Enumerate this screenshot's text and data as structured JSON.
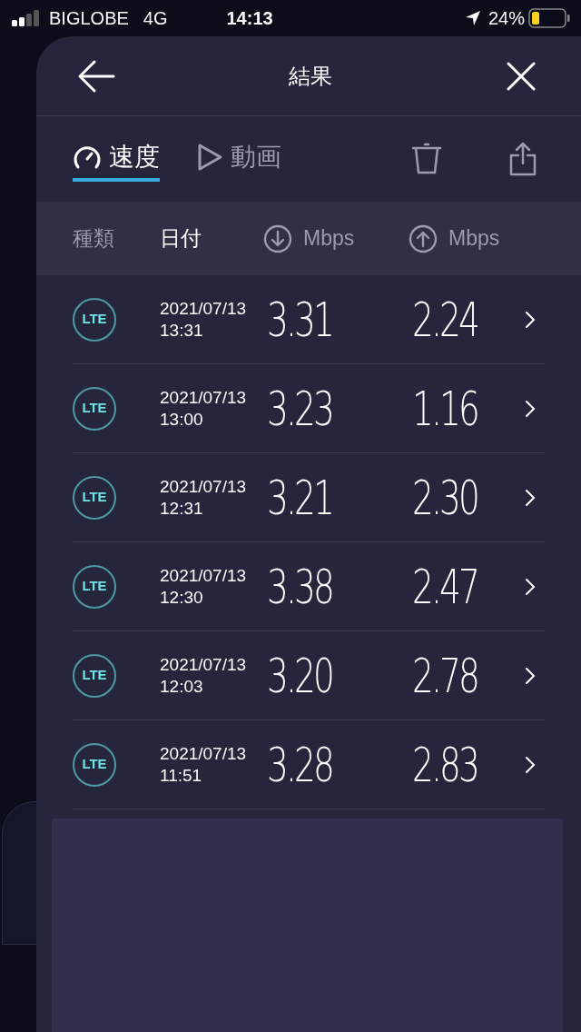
{
  "status_bar": {
    "carrier": "BIGLOBE",
    "network": "4G",
    "time": "14:13",
    "battery": "24%"
  },
  "header": {
    "title": "結果"
  },
  "tabs": [
    {
      "kind": "speed",
      "label": "速度",
      "selected": true
    },
    {
      "kind": "video",
      "label": "動画",
      "selected": false
    }
  ],
  "columns": [
    {
      "kind": "text",
      "label": "種類",
      "selected": false
    },
    {
      "kind": "text",
      "label": "日付",
      "selected": true
    },
    {
      "kind": "download",
      "label": "Mbps",
      "selected": false
    },
    {
      "kind": "upload",
      "label": "Mbps",
      "selected": false
    }
  ],
  "rows": [
    {
      "network": "LTE",
      "date": "2021/07/13",
      "time": "13:31",
      "download": "3.31",
      "upload": "2.24"
    },
    {
      "network": "LTE",
      "date": "2021/07/13",
      "time": "13:00",
      "download": "3.23",
      "upload": "1.16"
    },
    {
      "network": "LTE",
      "date": "2021/07/13",
      "time": "12:31",
      "download": "3.21",
      "upload": "2.30"
    },
    {
      "network": "LTE",
      "date": "2021/07/13",
      "time": "12:30",
      "download": "3.38",
      "upload": "2.47"
    },
    {
      "network": "LTE",
      "date": "2021/07/13",
      "time": "12:03",
      "download": "3.20",
      "upload": "2.78"
    },
    {
      "network": "LTE",
      "date": "2021/07/13",
      "time": "11:51",
      "download": "3.28",
      "upload": "2.83"
    }
  ]
}
